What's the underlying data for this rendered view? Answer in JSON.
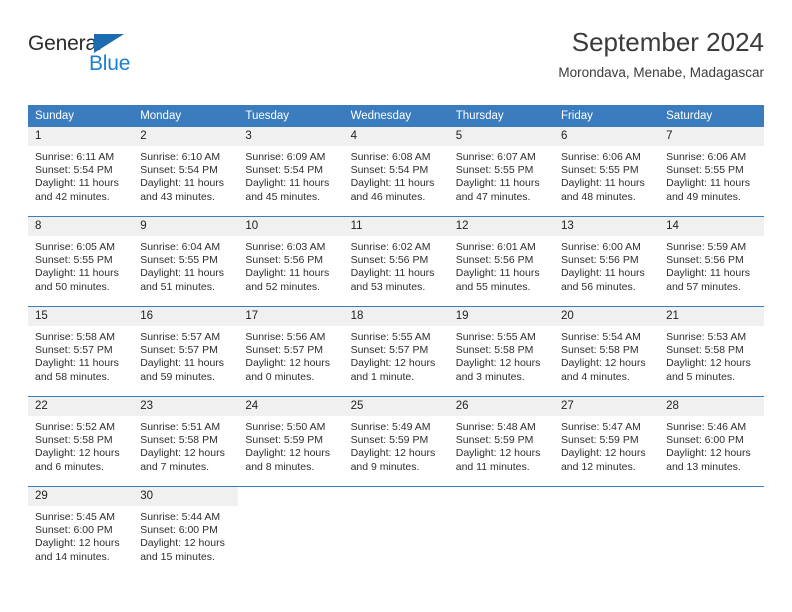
{
  "brand": {
    "name_top": "General",
    "name_bottom": "Blue",
    "triangle_color": "#1b6cb0",
    "blue_color": "#1b7fd4"
  },
  "header": {
    "title": "September 2024",
    "subtitle": "Morondava, Menabe, Madagascar"
  },
  "colors": {
    "header_blue": "#3a7cbe",
    "daynum_band": "#f0f0f0",
    "text": "#2e2e2e"
  },
  "weekday_headers": [
    "Sunday",
    "Monday",
    "Tuesday",
    "Wednesday",
    "Thursday",
    "Friday",
    "Saturday"
  ],
  "weeks": [
    [
      {
        "day": "1",
        "sunrise": "Sunrise: 6:11 AM",
        "sunset": "Sunset: 5:54 PM",
        "daylight1": "Daylight: 11 hours",
        "daylight2": "and 42 minutes."
      },
      {
        "day": "2",
        "sunrise": "Sunrise: 6:10 AM",
        "sunset": "Sunset: 5:54 PM",
        "daylight1": "Daylight: 11 hours",
        "daylight2": "and 43 minutes."
      },
      {
        "day": "3",
        "sunrise": "Sunrise: 6:09 AM",
        "sunset": "Sunset: 5:54 PM",
        "daylight1": "Daylight: 11 hours",
        "daylight2": "and 45 minutes."
      },
      {
        "day": "4",
        "sunrise": "Sunrise: 6:08 AM",
        "sunset": "Sunset: 5:54 PM",
        "daylight1": "Daylight: 11 hours",
        "daylight2": "and 46 minutes."
      },
      {
        "day": "5",
        "sunrise": "Sunrise: 6:07 AM",
        "sunset": "Sunset: 5:55 PM",
        "daylight1": "Daylight: 11 hours",
        "daylight2": "and 47 minutes."
      },
      {
        "day": "6",
        "sunrise": "Sunrise: 6:06 AM",
        "sunset": "Sunset: 5:55 PM",
        "daylight1": "Daylight: 11 hours",
        "daylight2": "and 48 minutes."
      },
      {
        "day": "7",
        "sunrise": "Sunrise: 6:06 AM",
        "sunset": "Sunset: 5:55 PM",
        "daylight1": "Daylight: 11 hours",
        "daylight2": "and 49 minutes."
      }
    ],
    [
      {
        "day": "8",
        "sunrise": "Sunrise: 6:05 AM",
        "sunset": "Sunset: 5:55 PM",
        "daylight1": "Daylight: 11 hours",
        "daylight2": "and 50 minutes."
      },
      {
        "day": "9",
        "sunrise": "Sunrise: 6:04 AM",
        "sunset": "Sunset: 5:55 PM",
        "daylight1": "Daylight: 11 hours",
        "daylight2": "and 51 minutes."
      },
      {
        "day": "10",
        "sunrise": "Sunrise: 6:03 AM",
        "sunset": "Sunset: 5:56 PM",
        "daylight1": "Daylight: 11 hours",
        "daylight2": "and 52 minutes."
      },
      {
        "day": "11",
        "sunrise": "Sunrise: 6:02 AM",
        "sunset": "Sunset: 5:56 PM",
        "daylight1": "Daylight: 11 hours",
        "daylight2": "and 53 minutes."
      },
      {
        "day": "12",
        "sunrise": "Sunrise: 6:01 AM",
        "sunset": "Sunset: 5:56 PM",
        "daylight1": "Daylight: 11 hours",
        "daylight2": "and 55 minutes."
      },
      {
        "day": "13",
        "sunrise": "Sunrise: 6:00 AM",
        "sunset": "Sunset: 5:56 PM",
        "daylight1": "Daylight: 11 hours",
        "daylight2": "and 56 minutes."
      },
      {
        "day": "14",
        "sunrise": "Sunrise: 5:59 AM",
        "sunset": "Sunset: 5:56 PM",
        "daylight1": "Daylight: 11 hours",
        "daylight2": "and 57 minutes."
      }
    ],
    [
      {
        "day": "15",
        "sunrise": "Sunrise: 5:58 AM",
        "sunset": "Sunset: 5:57 PM",
        "daylight1": "Daylight: 11 hours",
        "daylight2": "and 58 minutes."
      },
      {
        "day": "16",
        "sunrise": "Sunrise: 5:57 AM",
        "sunset": "Sunset: 5:57 PM",
        "daylight1": "Daylight: 11 hours",
        "daylight2": "and 59 minutes."
      },
      {
        "day": "17",
        "sunrise": "Sunrise: 5:56 AM",
        "sunset": "Sunset: 5:57 PM",
        "daylight1": "Daylight: 12 hours",
        "daylight2": "and 0 minutes."
      },
      {
        "day": "18",
        "sunrise": "Sunrise: 5:55 AM",
        "sunset": "Sunset: 5:57 PM",
        "daylight1": "Daylight: 12 hours",
        "daylight2": "and 1 minute."
      },
      {
        "day": "19",
        "sunrise": "Sunrise: 5:55 AM",
        "sunset": "Sunset: 5:58 PM",
        "daylight1": "Daylight: 12 hours",
        "daylight2": "and 3 minutes."
      },
      {
        "day": "20",
        "sunrise": "Sunrise: 5:54 AM",
        "sunset": "Sunset: 5:58 PM",
        "daylight1": "Daylight: 12 hours",
        "daylight2": "and 4 minutes."
      },
      {
        "day": "21",
        "sunrise": "Sunrise: 5:53 AM",
        "sunset": "Sunset: 5:58 PM",
        "daylight1": "Daylight: 12 hours",
        "daylight2": "and 5 minutes."
      }
    ],
    [
      {
        "day": "22",
        "sunrise": "Sunrise: 5:52 AM",
        "sunset": "Sunset: 5:58 PM",
        "daylight1": "Daylight: 12 hours",
        "daylight2": "and 6 minutes."
      },
      {
        "day": "23",
        "sunrise": "Sunrise: 5:51 AM",
        "sunset": "Sunset: 5:58 PM",
        "daylight1": "Daylight: 12 hours",
        "daylight2": "and 7 minutes."
      },
      {
        "day": "24",
        "sunrise": "Sunrise: 5:50 AM",
        "sunset": "Sunset: 5:59 PM",
        "daylight1": "Daylight: 12 hours",
        "daylight2": "and 8 minutes."
      },
      {
        "day": "25",
        "sunrise": "Sunrise: 5:49 AM",
        "sunset": "Sunset: 5:59 PM",
        "daylight1": "Daylight: 12 hours",
        "daylight2": "and 9 minutes."
      },
      {
        "day": "26",
        "sunrise": "Sunrise: 5:48 AM",
        "sunset": "Sunset: 5:59 PM",
        "daylight1": "Daylight: 12 hours",
        "daylight2": "and 11 minutes."
      },
      {
        "day": "27",
        "sunrise": "Sunrise: 5:47 AM",
        "sunset": "Sunset: 5:59 PM",
        "daylight1": "Daylight: 12 hours",
        "daylight2": "and 12 minutes."
      },
      {
        "day": "28",
        "sunrise": "Sunrise: 5:46 AM",
        "sunset": "Sunset: 6:00 PM",
        "daylight1": "Daylight: 12 hours",
        "daylight2": "and 13 minutes."
      }
    ],
    [
      {
        "day": "29",
        "sunrise": "Sunrise: 5:45 AM",
        "sunset": "Sunset: 6:00 PM",
        "daylight1": "Daylight: 12 hours",
        "daylight2": "and 14 minutes."
      },
      {
        "day": "30",
        "sunrise": "Sunrise: 5:44 AM",
        "sunset": "Sunset: 6:00 PM",
        "daylight1": "Daylight: 12 hours",
        "daylight2": "and 15 minutes."
      },
      {
        "day": "",
        "sunrise": "",
        "sunset": "",
        "daylight1": "",
        "daylight2": ""
      },
      {
        "day": "",
        "sunrise": "",
        "sunset": "",
        "daylight1": "",
        "daylight2": ""
      },
      {
        "day": "",
        "sunrise": "",
        "sunset": "",
        "daylight1": "",
        "daylight2": ""
      },
      {
        "day": "",
        "sunrise": "",
        "sunset": "",
        "daylight1": "",
        "daylight2": ""
      },
      {
        "day": "",
        "sunrise": "",
        "sunset": "",
        "daylight1": "",
        "daylight2": ""
      }
    ]
  ]
}
